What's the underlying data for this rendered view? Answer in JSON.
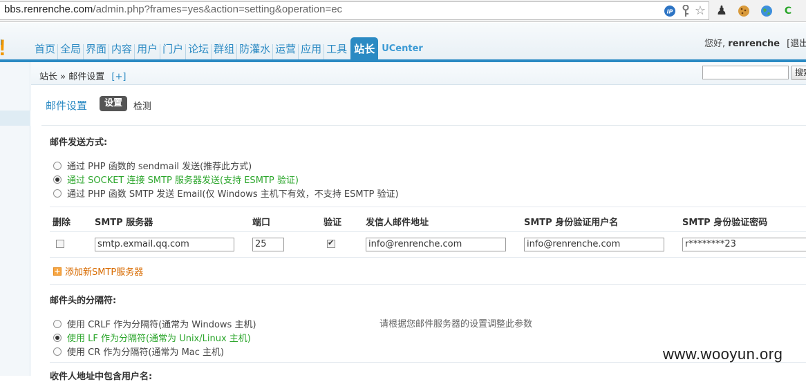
{
  "browser": {
    "url_host": "bbs.renrenche.com",
    "url_path": "/admin.php?frames=yes&action=setting&operation=ec",
    "icons": [
      "ip-icon",
      "key-icon",
      "star-icon",
      "pawn-icon",
      "cookie-icon",
      "globe-icon",
      "c-icon"
    ]
  },
  "header": {
    "logo_fragment": "!",
    "logo_sub": "l",
    "nav": [
      "首页",
      "全局",
      "界面",
      "内容",
      "用户",
      "门户",
      "论坛",
      "群组",
      "防灌水",
      "运营",
      "应用",
      "工具",
      "站长",
      "UCenter"
    ],
    "nav_active": "站长",
    "greeting_prefix": "您好,",
    "username": "renrenche",
    "logout": "[退出]"
  },
  "breadcrumb": {
    "root": "站长",
    "sep": "»",
    "current": "邮件设置",
    "add": "[+]"
  },
  "search": {
    "button": "搜索"
  },
  "page": {
    "title": "邮件设置",
    "tab_settings": "设置",
    "tab_check": "检测"
  },
  "send_method": {
    "label": "邮件发送方式:",
    "options": [
      "通过 PHP 函数的 sendmail 发送(推荐此方式)",
      "通过 SOCKET 连接 SMTP 服务器发送(支持 ESMTP 验证)",
      "通过 PHP 函数 SMTP 发送 Email(仅 Windows 主机下有效，不支持 ESMTP 验证)"
    ],
    "selected_index": 1
  },
  "smtp_table": {
    "headers": [
      "删除",
      "SMTP 服务器",
      "端口",
      "验证",
      "发信人邮件地址",
      "SMTP 身份验证用户名",
      "SMTP 身份验证密码"
    ],
    "row": {
      "delete_checked": false,
      "server": "smtp.exmail.qq.com",
      "port": "25",
      "auth_checked": true,
      "from": "info@renrenche.com",
      "username": "info@renrenche.com",
      "password": "r********23"
    },
    "add_label": "添加新SMTP服务器"
  },
  "separator": {
    "label": "邮件头的分隔符:",
    "hint": "请根据您邮件服务器的设置调整此参数",
    "options": [
      "使用 CRLF 作为分隔符(通常为 Windows 主机)",
      "使用 LF 作为分隔符(通常为 Unix/Linux 主机)",
      "使用 CR 作为分隔符(通常为 Mac 主机)"
    ],
    "selected_index": 1
  },
  "next_section_label": "收件人地址中包含用户名:",
  "watermark": "www.wooyun.org"
}
